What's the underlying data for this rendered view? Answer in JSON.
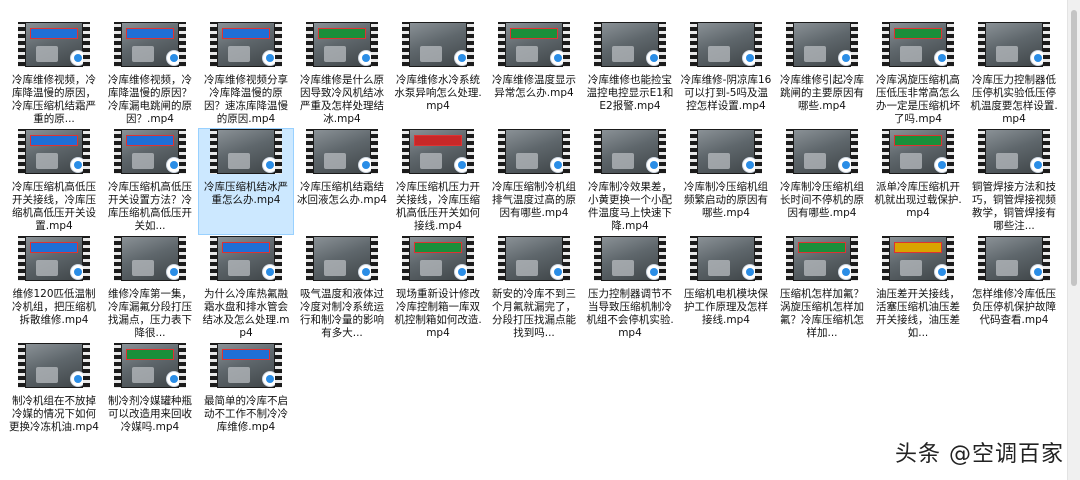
{
  "files": [
    {
      "name": "冷库维修视频，冷库降温慢的原因，冷库压缩机结霜严重的原...",
      "banner": "blue"
    },
    {
      "name": "冷库维修视频，冷库降温慢的原因？冷库漏电跳闸的原因？.mp4",
      "banner": "blue"
    },
    {
      "name": "冷库维修视频分享冷库降温慢的原因？速冻库降温慢的原因.mp4",
      "banner": "blue"
    },
    {
      "name": "冷库维修是什么原因导致冷风机结冰严重及怎样处理结冰.mp4",
      "banner": "green"
    },
    {
      "name": "冷库维修水冷系统水泵异响怎么处理.mp4",
      "banner": "none"
    },
    {
      "name": "冷库维修温度显示异常怎么办.mp4",
      "banner": "green"
    },
    {
      "name": "冷库维修也能捡宝温控电控显示E1和E2报警.mp4",
      "banner": "none"
    },
    {
      "name": "冷库维修-阴凉库16可以打到-5吗及温控怎样设置.mp4",
      "banner": "none"
    },
    {
      "name": "冷库维修引起冷库跳闸的主要原因有哪些.mp4",
      "banner": "none"
    },
    {
      "name": "冷库涡旋压缩机高压低压非常高怎么办一定是压缩机坏了吗.mp4",
      "banner": "green"
    },
    {
      "name": "冷库压力控制器低压停机实验低压停机温度要怎样设置.mp4",
      "banner": "none"
    },
    {
      "name": "冷库压缩机高低压开关接线，冷库压缩机高低压开关设置.mp4",
      "banner": "blue"
    },
    {
      "name": "冷库压缩机高低压开关设置方法？冷库压缩机高低压开关如...",
      "banner": "blue"
    },
    {
      "name": "冷库压缩机结冰严重怎么办.mp4",
      "banner": "none",
      "selected": true
    },
    {
      "name": "冷库压缩机结霜结冰回液怎么办.mp4",
      "banner": "none"
    },
    {
      "name": "冷库压缩机压力开关接线，冷库压缩机高低压开关如何接线.mp4",
      "banner": "red"
    },
    {
      "name": "冷库压缩制冷机组排气温度过高的原因有哪些.mp4",
      "banner": "none"
    },
    {
      "name": "冷库制冷效果差，小黄更换一个小配件温度马上快速下降.mp4",
      "banner": "none"
    },
    {
      "name": "冷库制冷压缩机组频繁启动的原因有哪些.mp4",
      "banner": "none"
    },
    {
      "name": "冷库制冷压缩机组长时间不停机的原因有哪些.mp4",
      "banner": "none"
    },
    {
      "name": "派单冷库压缩机开机就出现过载保护.mp4",
      "banner": "green"
    },
    {
      "name": "铜管焊接方法和技巧，铜管焊接视频教学，铜管焊接有哪些注...",
      "banner": "none"
    },
    {
      "name": "维修120匹低温制冷机组，把压缩机拆散维修.mp4",
      "banner": "blue"
    },
    {
      "name": "维修冷库第一集，冷库漏氟分段打压找漏点，压力表下降很...",
      "banner": "none"
    },
    {
      "name": "为什么冷库热氟融霜水盘和排水管会结冰及怎么处理.mp4",
      "banner": "blue"
    },
    {
      "name": "吸气温度和液体过冷度对制冷系统运行和制冷量的影响有多大...",
      "banner": "none"
    },
    {
      "name": "现场重新设计修改冷库控制箱一库双机控制箱如何改造.mp4",
      "banner": "green"
    },
    {
      "name": "新安的冷库不到三个月氟就漏完了，分段打压找漏点能找到吗...",
      "banner": "none"
    },
    {
      "name": "压力控制器调节不当导致压缩机制冷机组不会停机实验.mp4",
      "banner": "none"
    },
    {
      "name": "压缩机电机模块保护工作原理及怎样接线.mp4",
      "banner": "none"
    },
    {
      "name": "压缩机怎样加氟？涡旋压缩机怎样加氟？冷库压缩机怎样加...",
      "banner": "green"
    },
    {
      "name": "油压差开关接线，活塞压缩机油压差开关接线，油压差如...",
      "banner": "yellow"
    },
    {
      "name": "怎样维修冷库低压负压停机保护故障代码查看.mp4",
      "banner": "none"
    },
    {
      "name": "制冷机组在不放掉冷媒的情况下如何更换冷冻机油.mp4",
      "banner": "none"
    },
    {
      "name": "制冷剂冷媒罐种瓶可以改造用来回收冷媒吗.mp4",
      "banner": "green"
    },
    {
      "name": "最简单的冷库不启动不工作不制冷冷库维修.mp4",
      "banner": "blue"
    }
  ],
  "watermark": "头条 @空调百家",
  "icons": {
    "thumbnail": "video-file-icon",
    "overlay": "edge-app-icon"
  }
}
